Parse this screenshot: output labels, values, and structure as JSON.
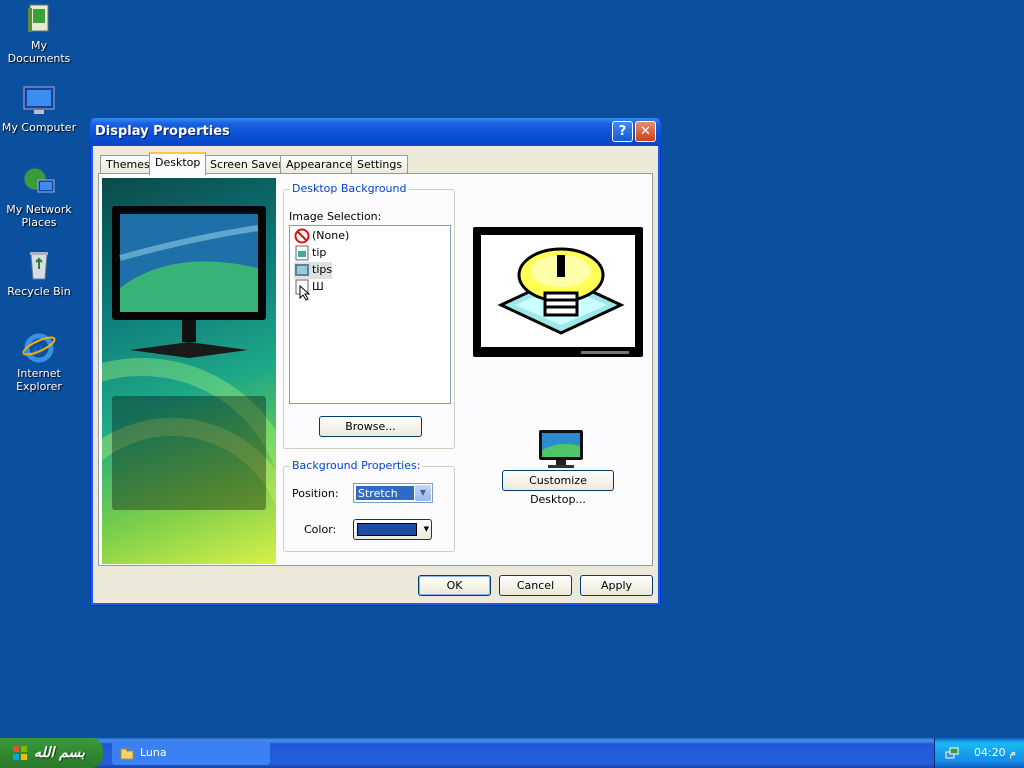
{
  "desktop": {
    "icons": [
      {
        "label": "My Documents"
      },
      {
        "label": "My Computer"
      },
      {
        "label": "My Network Places"
      },
      {
        "label": "Recycle Bin"
      },
      {
        "label": "Internet Explorer"
      }
    ]
  },
  "window": {
    "title": "Display Properties",
    "tabs": [
      "Themes",
      "Desktop",
      "Screen Saver",
      "Appearance",
      "Settings"
    ],
    "active_tab": "Desktop",
    "desktop_background": {
      "group_title": "Desktop Background",
      "image_selection_label": "Image Selection:",
      "items": [
        "(None)",
        "tip",
        "tips",
        "Ш"
      ],
      "selected_item": "tips",
      "browse_label": "Browse..."
    },
    "background_properties": {
      "group_title": "Background Properties:",
      "position_label": "Position:",
      "position_value": "Stretch",
      "color_label": "Color:",
      "color_value": "#1c4ca3"
    },
    "customize_label": "Customize Desktop...",
    "buttons": {
      "ok": "OK",
      "cancel": "Cancel",
      "apply": "Apply"
    }
  },
  "taskbar": {
    "start_label": "بسم الله",
    "task_label": "Luna",
    "clock": "04:20 م"
  }
}
